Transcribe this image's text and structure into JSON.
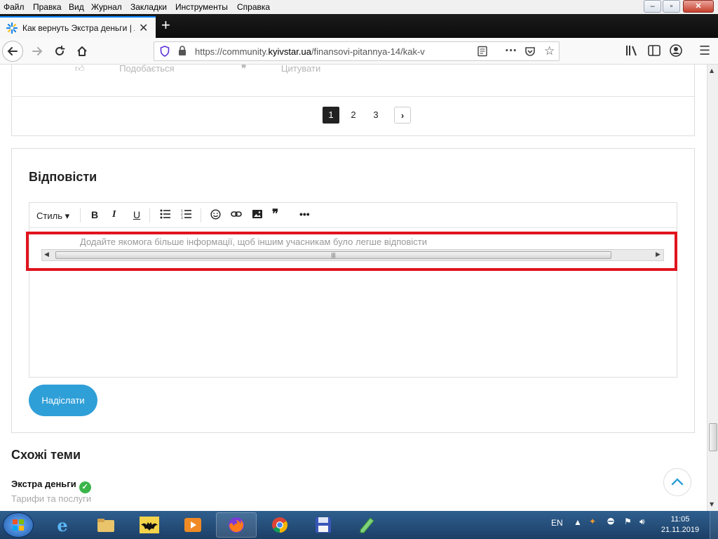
{
  "menubar": {
    "items": [
      "Файл",
      "Правка",
      "Вид",
      "Журнал",
      "Закладки",
      "Инструменты",
      "Справка"
    ]
  },
  "window_controls": {
    "minimize": "–",
    "maximize": "▫",
    "close": "✕"
  },
  "tab": {
    "title": "Как вернуть Экстра деньги | Л",
    "close": "✕"
  },
  "new_tab": "+",
  "urlbar": {
    "prefix": "https://community.",
    "domain": "kyivstar.ua",
    "path": "/finansovi-pitannya-14/kak-v"
  },
  "post_actions": {
    "like": "Подобається",
    "quote": "Цитувати"
  },
  "pagination": {
    "pages": [
      "1",
      "2",
      "3"
    ],
    "active": "1",
    "next": "›"
  },
  "reply": {
    "title": "Відповісти",
    "toolbar": {
      "style_label": "Стиль ▾",
      "bold": "B",
      "italic": "I",
      "underline": "U",
      "more": "•••"
    },
    "placeholder": "Додайте якомога більше інформації, щоб іншим учасникам було легше відповісти",
    "submit": "Надіслати"
  },
  "related": {
    "title": "Схожі теми",
    "items": [
      {
        "title": "Экстра деньги",
        "category": "Тарифи та послуги"
      }
    ]
  },
  "taskbar": {
    "tray_lang": "EN",
    "time": "11:05",
    "date": "21.11.2019"
  },
  "colors": {
    "accent": "#2f9fd8",
    "highlight_box": "#e0141e",
    "check_green": "#3bb54a"
  }
}
